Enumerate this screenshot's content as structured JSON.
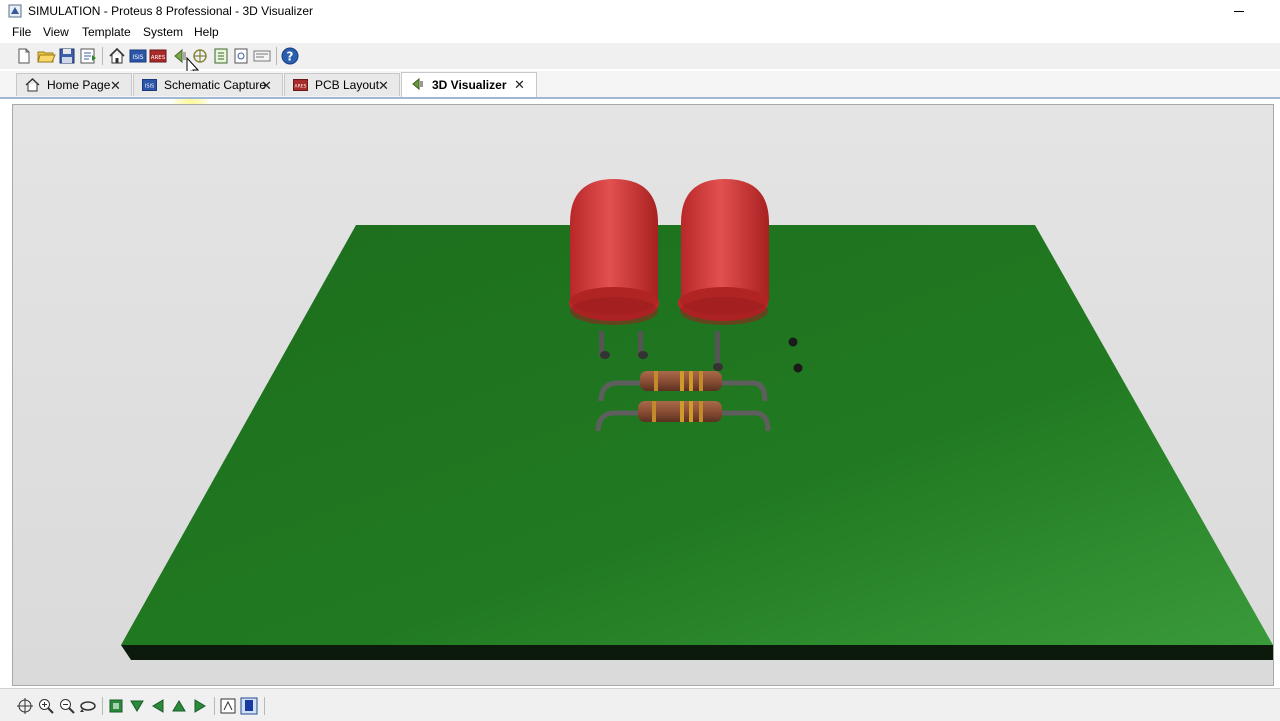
{
  "window": {
    "title": "SIMULATION - Proteus 8 Professional - 3D Visualizer"
  },
  "menu": {
    "items": [
      {
        "label": "File"
      },
      {
        "label": "View"
      },
      {
        "label": "Template"
      },
      {
        "label": "System"
      },
      {
        "label": "Help"
      }
    ]
  },
  "toolbar": {
    "icons": [
      "new-file-icon",
      "open-folder-icon",
      "save-icon",
      "import-icon",
      "home-icon",
      "isis-schematic-icon",
      "ares-pcb-icon",
      "back-icon",
      "gerber-viewer-icon",
      "bom-icon",
      "design-explorer-icon",
      "code-icon",
      "help-icon"
    ]
  },
  "tabs": [
    {
      "label": "Home Page",
      "icon": "home-icon",
      "active": false
    },
    {
      "label": "Schematic Capture",
      "icon": "schematic-icon",
      "active": false
    },
    {
      "label": "PCB Layout",
      "icon": "pcb-icon",
      "active": false
    },
    {
      "label": "3D Visualizer",
      "icon": "visualizer-icon",
      "active": true
    }
  ],
  "scene": {
    "board_color": "#1f7a1f",
    "led_color": "#d23a3a",
    "led_count": 2,
    "resistor_count": 2
  },
  "bottom_toolbar": {
    "icons": [
      "pan-icon",
      "zoom-in-icon",
      "zoom-out-icon",
      "rotate-icon",
      "view-top-icon",
      "view-front-icon",
      "view-left-icon",
      "view-back-icon",
      "view-right-icon",
      "board-view-icon",
      "show-components-icon"
    ]
  }
}
